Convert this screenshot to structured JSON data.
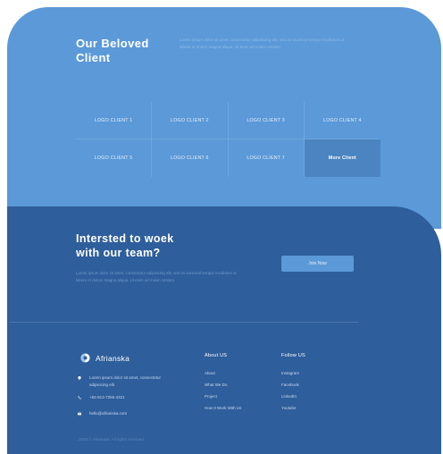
{
  "clients": {
    "title_line1": "Our Beloved",
    "title_line2": "Client",
    "description": "Lorem ipsum dolor sit amet, consectetur adipisicing elit, sed do eiusmod tempor incididunt ut labore et dolore magna aliqua. Ut enim ad minim veniam.",
    "logos": [
      "LOGO CLIENT 1",
      "LOGO CLIENT 2",
      "LOGO CLIENT 3",
      "LOGO CLIENT 4",
      "LOGO CLIENT 5",
      "LOGO CLIENT 6",
      "LOGO CLIENT 7"
    ],
    "more_label": "More Client"
  },
  "cta": {
    "title_line1": "Intersted to woek",
    "title_line2": "with our team?",
    "description": "Lorem ipsum dolor sit amet, consectetur adipisicing elit, sed do eiusmod tempor incididunt ut labore et dolore magna aliqua. Ut enim ad minim veniam.",
    "button_label": "Join Now"
  },
  "footer": {
    "brand_name": "Afrianska",
    "address": "Lorem ipsum dolor sit amet, consectetur adipisicing elit",
    "phone": "+62-813-7255-4321",
    "email": "hello@afrianska.com",
    "about_title": "About US",
    "about_links": [
      "About",
      "What We Do",
      "Project",
      "How It Work With Us"
    ],
    "follow_title": "Follow US",
    "follow_links": [
      "Instagram",
      "Facebook",
      "LinkedIn",
      "Youtube"
    ],
    "copyright": "2020 © Afrianska. All rights reserved."
  },
  "colors": {
    "clients_bg": "#5b99d8",
    "footer_bg": "#2e5e9b",
    "more_bg": "#4b84c0",
    "button_bg": "#5b99d8"
  },
  "icons": {
    "brand": "afrianska-logo-icon",
    "address": "location-icon",
    "phone": "phone-icon",
    "email": "email-icon"
  }
}
